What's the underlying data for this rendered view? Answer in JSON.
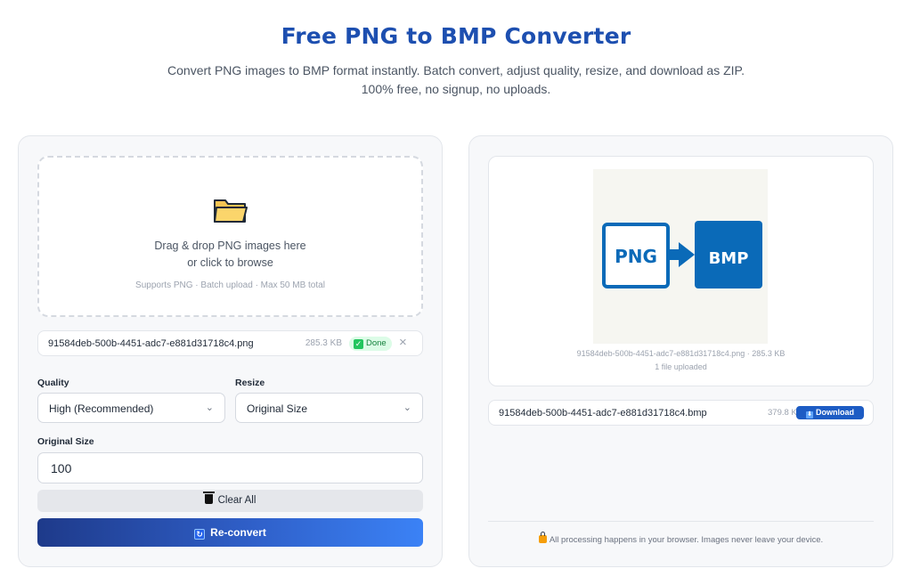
{
  "header": {
    "title": "Free PNG to BMP Converter",
    "subtitle": "Convert PNG images to BMP format instantly. Batch convert, adjust quality, resize, and download as ZIP. 100% free, no signup, no uploads."
  },
  "upload": {
    "icon": "folder-icon",
    "line1": "Drag & drop PNG images here",
    "line2": "or click to browse",
    "hint": "Supports PNG · Batch upload · Max 50 MB total"
  },
  "input_file": {
    "name": "91584deb-500b-4451-adc7-e881d31718c4.png",
    "size": "285.3 KB",
    "status": "Done",
    "status_color": "#22c55e"
  },
  "settings": {
    "quality_label": "Quality",
    "quality_value": "High (Recommended)",
    "resize_label": "Resize",
    "resize_value": "Original Size",
    "size_label": "Original Size",
    "size_value": "100"
  },
  "actions": {
    "clear_label": "Clear All",
    "reconvert_label": "Re-convert"
  },
  "preview": {
    "png_label": "PNG",
    "bmp_label": "BMP",
    "meta": "91584deb-500b-4451-adc7-e881d31718c4.png · 285.3 KB",
    "count": "1 file uploaded"
  },
  "output_file": {
    "name": "91584deb-500b-4451-adc7-e881d31718c4.bmp",
    "size": "379.8 KB",
    "download_label": "Download"
  },
  "footer": {
    "privacy": "All processing happens in your browser. Images never leave your device."
  },
  "colors": {
    "title": "#1d4fb0",
    "accent": "#1d5cc4",
    "logo_blue": "#0a6ab8"
  }
}
